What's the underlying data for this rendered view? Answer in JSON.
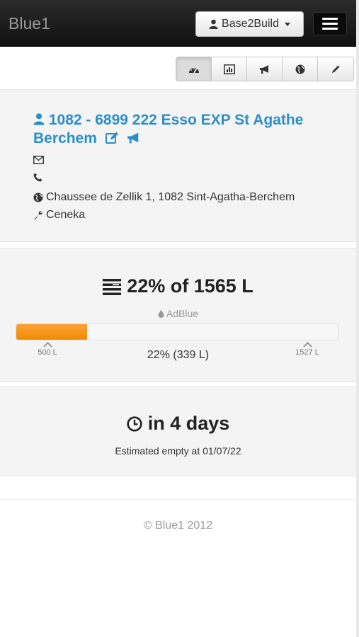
{
  "navbar": {
    "brand": "Blue1",
    "account_label": "Base2Build",
    "account_icon": "user-icon",
    "menu_icon": "hamburger-icon"
  },
  "toolbar": {
    "buttons": [
      {
        "icon": "dashboard-icon",
        "active": true
      },
      {
        "icon": "chart-icon",
        "active": false
      },
      {
        "icon": "megaphone-icon",
        "active": false
      },
      {
        "icon": "globe-icon",
        "active": false
      },
      {
        "icon": "pencil-icon",
        "active": false
      }
    ]
  },
  "station": {
    "title_line1": "1082 - 6899 222 Esso EXP St Agathe",
    "title_line2": "Berchem",
    "title_color": "#2a8fc9",
    "email": "",
    "phone": "",
    "address": "Chaussee de Zellik 1, 1082 Sint-Agatha-Berchem",
    "technician": "Ceneka"
  },
  "level": {
    "heading": "22% of 1565 L",
    "product": "AdBlue",
    "fill_percent": 22,
    "bar_color": "#f7941d",
    "min_label": "500 L",
    "max_label": "1527 L",
    "current_text": "22% (339 L)"
  },
  "forecast": {
    "heading": "in 4 days",
    "subtext": "Estimated empty at 01/07/22"
  },
  "footer": {
    "copyright": "© Blue1 2012"
  }
}
